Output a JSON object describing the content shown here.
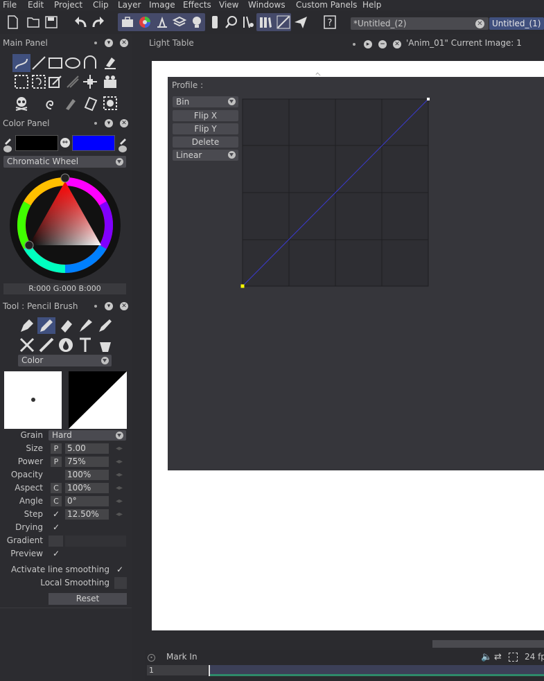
{
  "menu": [
    "File",
    "Edit",
    "Project",
    "Clip",
    "Layer",
    "Image",
    "Effects",
    "View",
    "Windows",
    "Custom Panels",
    "Help"
  ],
  "tabs": {
    "tab1": "*Untitled_(2)",
    "tab2": "Untitled_(1)"
  },
  "main_panel": {
    "title": "Main Panel"
  },
  "color_panel": {
    "title": "Color Panel",
    "mode": "Chromatic Wheel",
    "readout": "R:000 G:000 B:000",
    "fg_color": "#000000",
    "bg_color": "#0000ff"
  },
  "tool_panel": {
    "title": "Tool : Pencil Brush",
    "color_mode": "Color",
    "grain_label": "Grain",
    "grain_value": "Hard",
    "size_label": "Size",
    "size_value": "5.00",
    "power_label": "Power",
    "power_value": "75%",
    "opacity_label": "Opacity",
    "opacity_value": "100%",
    "aspect_label": "Aspect",
    "aspect_value": "100%",
    "angle_label": "Angle",
    "angle_value": "0°",
    "step_label": "Step",
    "step_value": "12.50%",
    "drying_label": "Drying",
    "gradient_label": "Gradient",
    "preview_label": "Preview",
    "smoothing_label": "Activate line smoothing",
    "local_smoothing_label": "Local Smoothing",
    "reset_label": "Reset",
    "p_label": "P",
    "c_label": "C"
  },
  "light_table": {
    "title": "Light Table",
    "anim_label": "'Anim_01\"  Current Image: 1"
  },
  "profile": {
    "title": "Profile :",
    "mode": "Bin",
    "flip_x": "Flip X",
    "flip_y": "Flip Y",
    "delete": "Delete",
    "interp": "Linear"
  },
  "timeline": {
    "mark_in": "Mark In",
    "frame": "1",
    "fps": "24 fp"
  }
}
